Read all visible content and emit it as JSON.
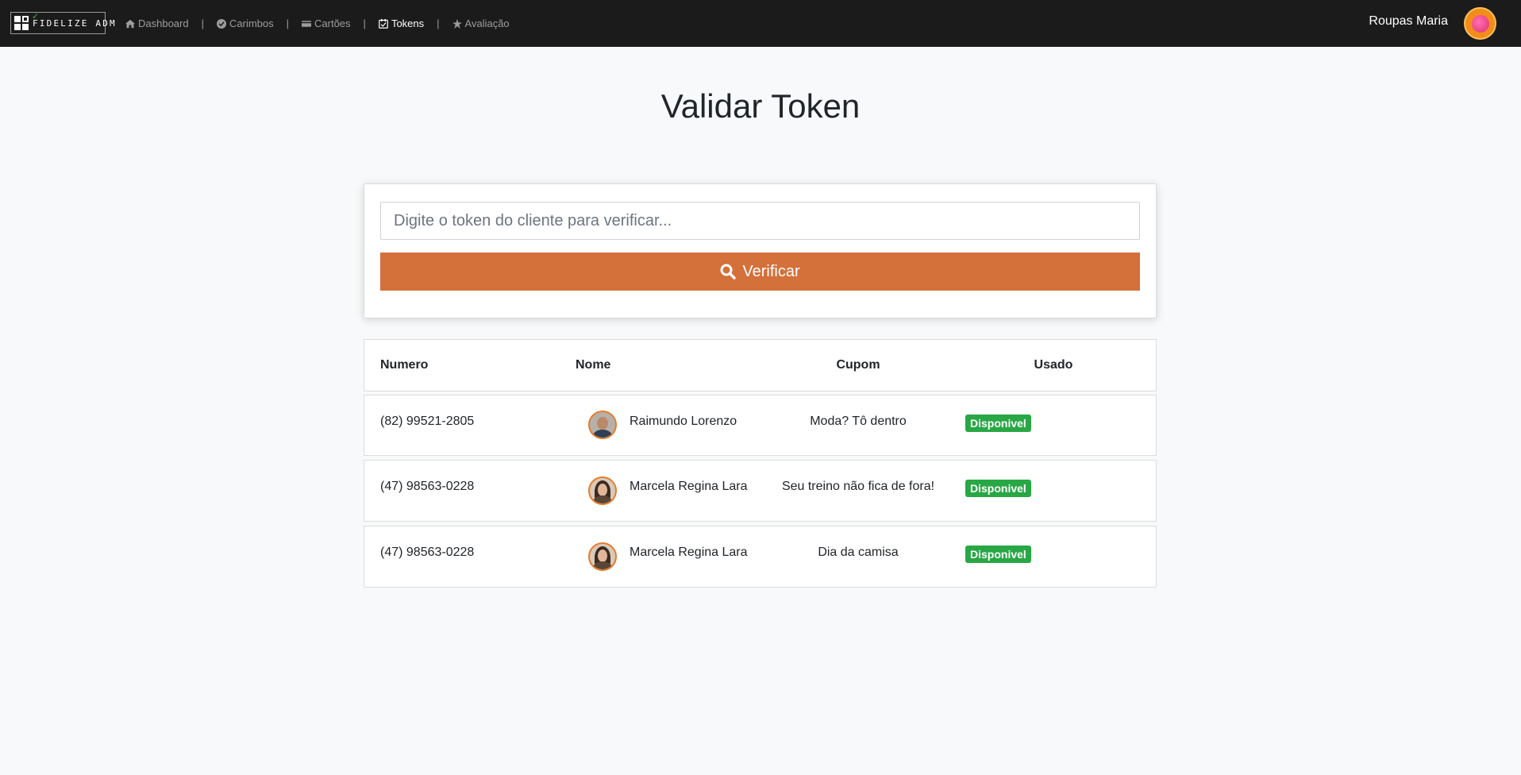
{
  "navbar": {
    "brand": "FIDELIZE ADM",
    "items": [
      {
        "label": "Dashboard",
        "icon": "home-icon"
      },
      {
        "label": "Carimbos",
        "icon": "check-circle-icon"
      },
      {
        "label": "Cartões",
        "icon": "card-icon"
      },
      {
        "label": "Tokens",
        "icon": "calendar-check-icon",
        "active": true
      },
      {
        "label": "Avaliação",
        "icon": "star-icon"
      }
    ],
    "separator": "|",
    "user_name": "Roupas Maria"
  },
  "page_title": "Validar Token",
  "search": {
    "placeholder": "Digite o token do cliente para verificar...",
    "button_label": "Verificar"
  },
  "table": {
    "headers": [
      "Numero",
      "Nome",
      "Cupom",
      "Usado"
    ],
    "rows": [
      {
        "numero": "(82) 99521-2805",
        "nome": "Raimundo Lorenzo",
        "cupom": "Moda? Tô dentro",
        "usado": "Disponivel"
      },
      {
        "numero": "(47) 98563-0228",
        "nome": "Marcela Regina Lara",
        "cupom": "Seu treino não fica de fora!",
        "usado": "Disponivel"
      },
      {
        "numero": "(47) 98563-0228",
        "nome": "Marcela Regina Lara",
        "cupom": "Dia da camisa",
        "usado": "Disponivel"
      }
    ]
  },
  "colors": {
    "navbar_bg": "#1b1b1b",
    "accent": "#d4703a",
    "badge": "#28a745"
  }
}
